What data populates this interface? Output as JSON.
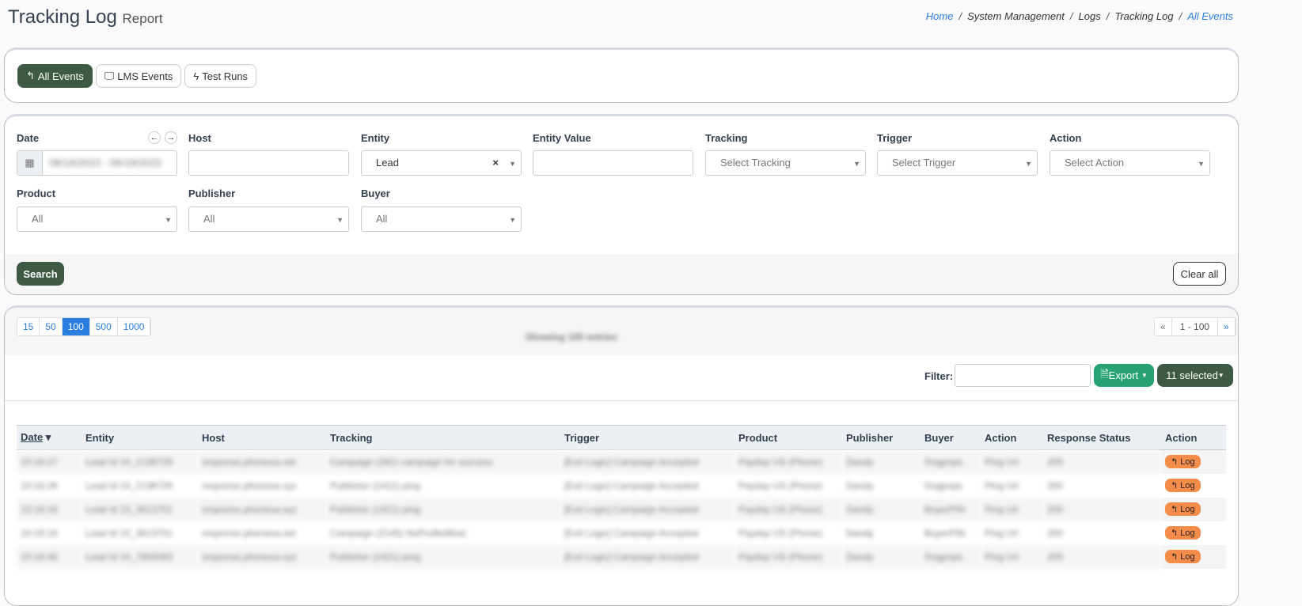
{
  "header": {
    "title": "Tracking Log",
    "subtitle": "Report"
  },
  "breadcrumb": [
    "Home",
    "System Management",
    "Logs",
    "Tracking Log",
    "All Events"
  ],
  "tabs": [
    {
      "label": "All Events",
      "icon": "reply-icon",
      "active": true
    },
    {
      "label": "LMS Events",
      "icon": "monitor-icon"
    },
    {
      "label": "Test Runs",
      "icon": "bolt-icon"
    }
  ],
  "filters": {
    "date": {
      "label": "Date",
      "value": "08/19/2023 - 08/19/2023"
    },
    "host": {
      "label": "Host",
      "value": ""
    },
    "entity": {
      "label": "Entity",
      "value": "Lead"
    },
    "entity_value": {
      "label": "Entity Value",
      "value": ""
    },
    "tracking": {
      "label": "Tracking",
      "placeholder": "Select Tracking"
    },
    "trigger": {
      "label": "Trigger",
      "placeholder": "Select Trigger"
    },
    "action": {
      "label": "Action",
      "placeholder": "Select Action"
    },
    "product": {
      "label": "Product",
      "value": "All"
    },
    "publisher": {
      "label": "Publisher",
      "value": "All"
    },
    "buyer": {
      "label": "Buyer",
      "value": "All"
    },
    "search_label": "Search",
    "clear_label": "Clear all"
  },
  "results": {
    "page_sizes": [
      "15",
      "50",
      "100",
      "500",
      "1000"
    ],
    "active_page_size": "100",
    "showing": "Showing 100 entries",
    "pager": {
      "prev": "«",
      "range": "1 - 100",
      "next": "»"
    },
    "filter_label": "Filter:",
    "export_label": "Export",
    "selected_label": "11 selected",
    "columns": [
      "Date",
      "Entity",
      "Host",
      "Tracking",
      "Trigger",
      "Product",
      "Publisher",
      "Buyer",
      "Action",
      "Response Status",
      "Action"
    ],
    "log_label": "Log",
    "rows": [
      [
        "10:16:27",
        "Lead Id 10_2138729",
        "response.phonesa.net",
        "Campaign (281) campaign for success",
        "[Exit Logic] Campaign Accepted",
        "Payday US (Phone)",
        "Dandy",
        "Dogpops",
        "Ping Url",
        "200"
      ],
      [
        "10:16:26",
        "Lead Id 10_2138729",
        "response.phonesa.xyz",
        "Publisher (1421) ping",
        "[Exit Logic] Campaign Accepted",
        "Payday US (Phone)",
        "Dandy",
        "Dogpops",
        "Ping Url",
        "200"
      ],
      [
        "10:16:16",
        "Lead Id 10_3613701",
        "response.phonesa.xyz",
        "Publisher (1421) ping",
        "[Exit Logic] Campaign Accepted",
        "Payday US (Phone)",
        "Dandy",
        "BuyerPIN",
        "Ping Url",
        "200"
      ],
      [
        "10:16:16",
        "Lead Id 10_3613701",
        "response.phonesa.net",
        "Campaign (2145) NoProfitsMost",
        "[Exit Logic] Campaign Accepted",
        "Payday US (Phone)",
        "Dandy",
        "BuyerPIN",
        "Ping Url",
        "200"
      ],
      [
        "10:16:06",
        "Lead Id 10_7859363",
        "response.phonesa.xyz",
        "Publisher (1421) ping",
        "[Exit Logic] Campaign Accepted",
        "Payday US (Phone)",
        "Dandy",
        "Dogpops",
        "Ping Url",
        "200"
      ]
    ]
  },
  "colors": {
    "primary": "#3d5a45",
    "export": "#27a373",
    "link": "#2a7de1",
    "log": "#f68c4a"
  }
}
